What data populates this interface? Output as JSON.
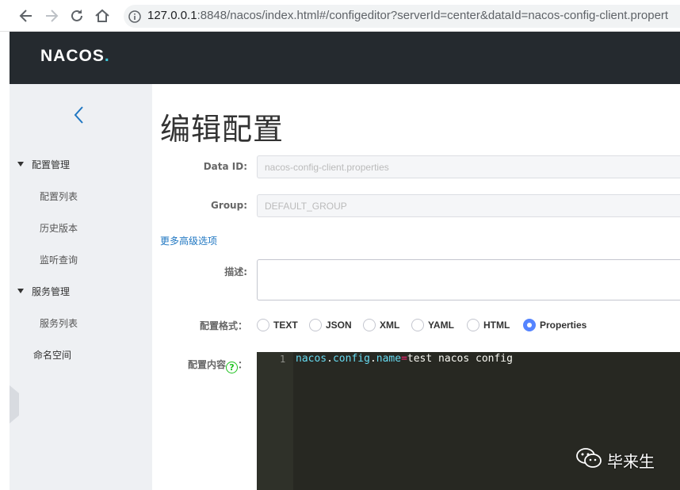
{
  "browser": {
    "url_host": "127.0.0.1",
    "url_rest": ":8848/nacos/index.html#/configeditor?serverId=center&dataId=nacos-config-client.propert"
  },
  "header": {
    "logo_main": "NACOS",
    "logo_dot": "."
  },
  "sidebar": {
    "groups": [
      {
        "label": "配置管理",
        "items": [
          "配置列表",
          "历史版本",
          "监听查询"
        ]
      },
      {
        "label": "服务管理",
        "items": [
          "服务列表"
        ]
      }
    ],
    "namespace": "命名空间"
  },
  "main": {
    "title": "编辑配置",
    "data_id_label": "Data ID:",
    "data_id_value": "nacos-config-client.properties",
    "group_label": "Group:",
    "group_value": "DEFAULT_GROUP",
    "advanced_link": "更多高级选项",
    "desc_label": "描述:",
    "format_label": "配置格式：",
    "formats": [
      "TEXT",
      "JSON",
      "XML",
      "YAML",
      "HTML",
      "Properties"
    ],
    "selected_format": "Properties",
    "content_label": "配置内容",
    "content_colon": "：",
    "help_glyph": "?",
    "editor": {
      "line_number": "1",
      "code_tokens": [
        "nacos",
        ".",
        "config",
        ".",
        "name",
        "=",
        "test nacos config"
      ]
    }
  },
  "watermark": {
    "text": "毕来生"
  },
  "colors": {
    "header_bg": "#252a2f",
    "sidebar_bg": "#eef0f3",
    "radio_selected": "#5584ff",
    "link": "#2077c2",
    "editor_bg": "#272822"
  }
}
